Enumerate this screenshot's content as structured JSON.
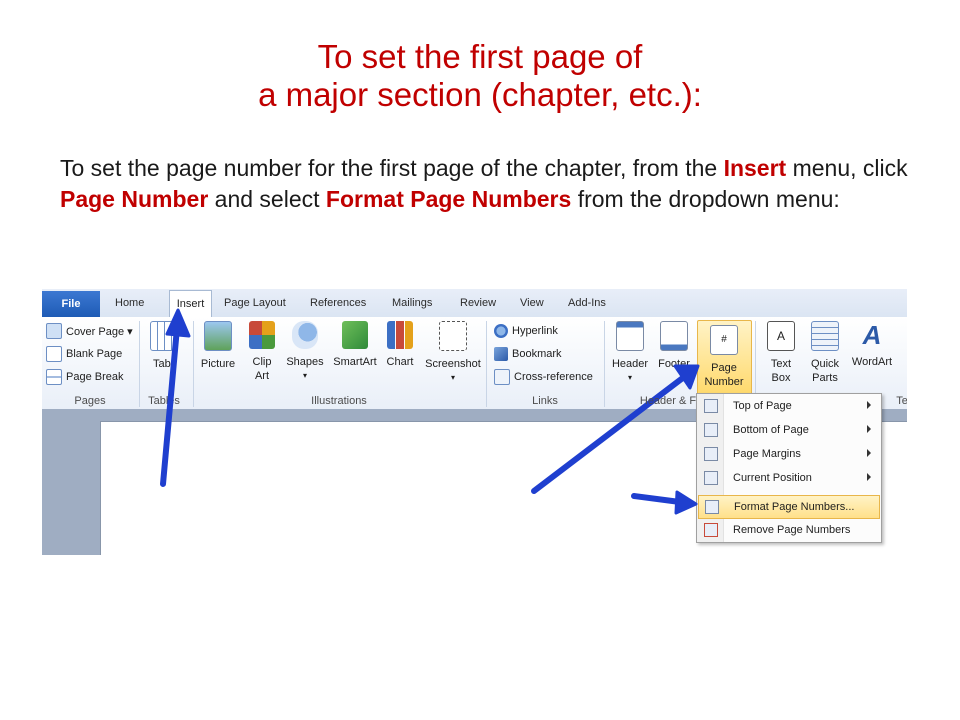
{
  "slide": {
    "title_line1": "To set the first page of",
    "title_line2": "a major section (chapter, etc.):",
    "body": {
      "part1": "To set the page number for the first page of the chapter, from the ",
      "insert": "Insert",
      "part2": " menu, click ",
      "page_number": "Page Number",
      "part3": " and select ",
      "format_page_numbers": "Format Page Numbers",
      "part4": " from the dropdown menu:"
    }
  },
  "ribbon": {
    "tabs": [
      "File",
      "Home",
      "Insert",
      "Page Layout",
      "References",
      "Mailings",
      "Review",
      "View",
      "Add-Ins"
    ],
    "pages_group": {
      "items": [
        "Cover Page ▾",
        "Blank Page",
        "Page Break"
      ],
      "label": "Pages"
    },
    "tables_group": {
      "button": "Table",
      "label": "Tables"
    },
    "illustrations_group": {
      "buttons": [
        "Picture",
        "Clip Art",
        "Shapes",
        "SmartArt",
        "Chart",
        "Screenshot"
      ],
      "label": "Illustrations"
    },
    "links_group": {
      "items": [
        "Hyperlink",
        "Bookmark",
        "Cross-reference"
      ],
      "label": "Links"
    },
    "header_footer_group": {
      "buttons": [
        "Header",
        "Footer",
        "Page Number"
      ],
      "label": "Header & F"
    },
    "text_group": {
      "buttons": [
        "Text Box",
        "Quick Parts",
        "WordArt"
      ],
      "label": "Te"
    }
  },
  "dropdown": {
    "items": [
      "Top of Page",
      "Bottom of Page",
      "Page Margins",
      "Current Position",
      "Format Page Numbers...",
      "Remove Page Numbers"
    ],
    "active_index": 4
  },
  "colors": {
    "accent_red": "#c00000",
    "arrow_blue": "#1f3fcf",
    "file_tab": "#2a67c6"
  }
}
